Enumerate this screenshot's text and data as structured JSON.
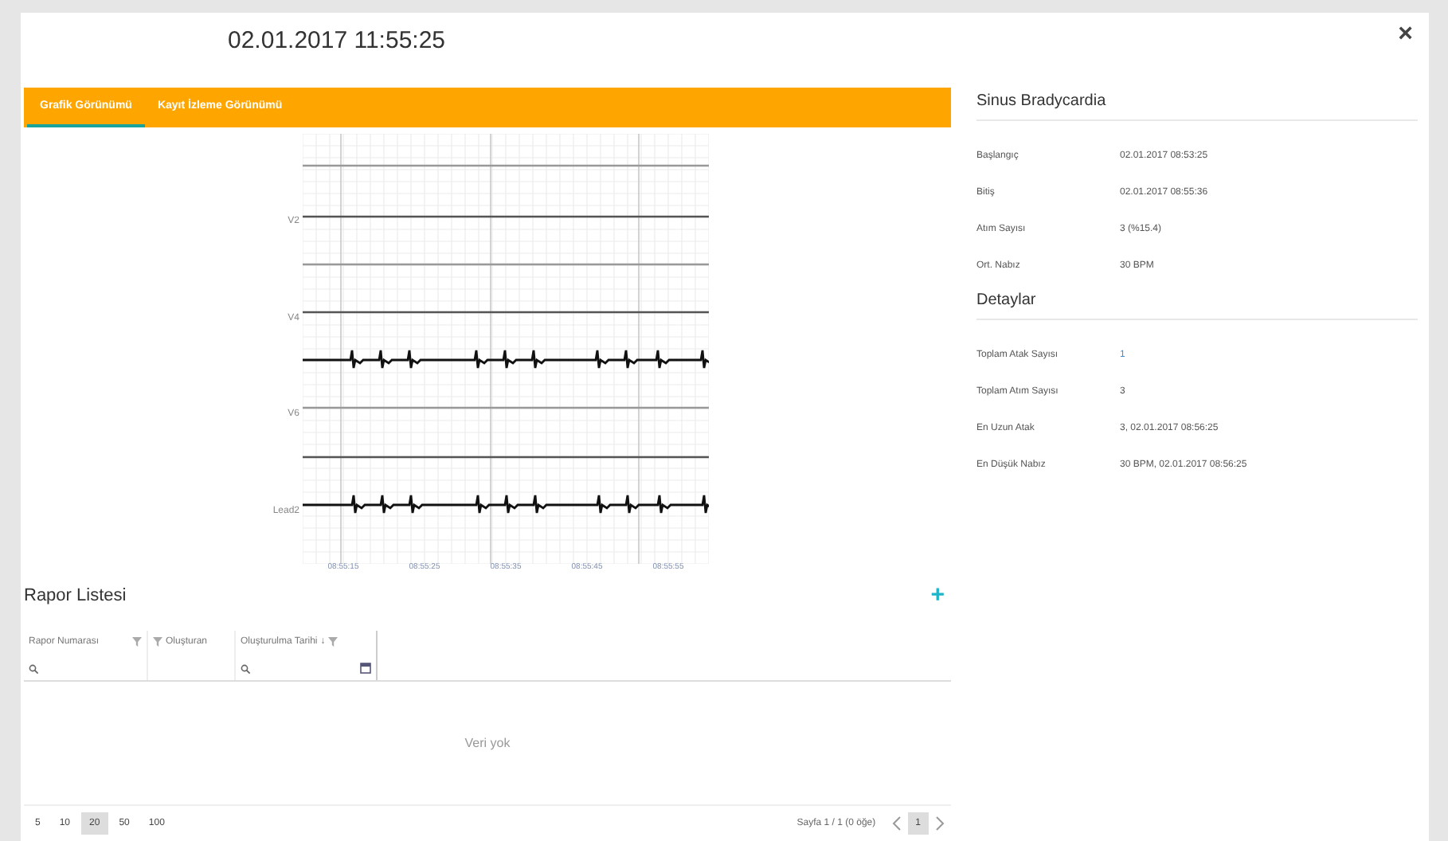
{
  "window": {
    "title": "02.01.2017 11:55:25",
    "close": "×"
  },
  "tabs": [
    {
      "label": "Grafik Görünümü",
      "selected": true
    },
    {
      "label": "Kayıt İzleme Görünümü",
      "selected": false
    }
  ],
  "ecg": {
    "leads": [
      "V2",
      "V4",
      "V6",
      "Lead2"
    ],
    "time_labels": [
      "08:55:15",
      "08:55:25",
      "08:55:35",
      "08:55:45",
      "08:55:55"
    ]
  },
  "summary": {
    "title": "Sinus Bradycardia",
    "rows": [
      {
        "label": "Başlangıç",
        "value": "02.01.2017 08:53:25"
      },
      {
        "label": "Bitiş",
        "value": "02.01.2017 08:55:36"
      },
      {
        "label": "Atım Sayısı",
        "value": "3 (%15.4)"
      },
      {
        "label": "Ort. Nabız",
        "value": "30 BPM"
      }
    ]
  },
  "details": {
    "title": "Detaylar",
    "rows": [
      {
        "label": "Toplam Atak Sayısı",
        "value": "1",
        "link": true
      },
      {
        "label": "Toplam Atım Sayısı",
        "value": "3",
        "link": false
      },
      {
        "label": "En Uzun Atak",
        "value": "3, 02.01.2017 08:56:25",
        "link": false
      },
      {
        "label": "En Düşük Nabız",
        "value": "30 BPM, 02.01.2017 08:56:25",
        "link": false
      }
    ]
  },
  "report_list": {
    "title": "Rapor Listesi",
    "add": "+",
    "columns": [
      {
        "label": "Rapor Numarası"
      },
      {
        "label": "Oluşturan"
      },
      {
        "label": "Oluşturulma Tarihi",
        "sort": "↓"
      }
    ],
    "empty": "Veri yok",
    "page_sizes": [
      {
        "label": "5",
        "selected": false
      },
      {
        "label": "10",
        "selected": false
      },
      {
        "label": "20",
        "selected": true
      },
      {
        "label": "50",
        "selected": false
      },
      {
        "label": "100",
        "selected": false
      }
    ],
    "page_info": "Sayfa 1 / 1 (0 öğe)",
    "pages": [
      {
        "label": "1",
        "selected": true
      }
    ]
  }
}
